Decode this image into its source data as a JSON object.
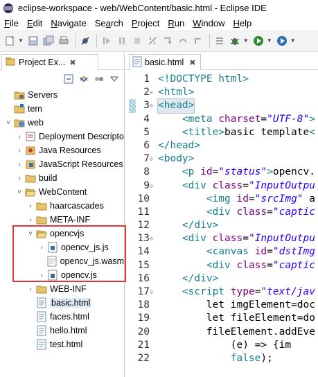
{
  "window": {
    "title": "eclipse-workspace - web/WebContent/basic.html - Eclipse IDE"
  },
  "menu": [
    {
      "label": "File",
      "mnemonic": "F"
    },
    {
      "label": "Edit",
      "mnemonic": "E"
    },
    {
      "label": "Navigate",
      "mnemonic": "N"
    },
    {
      "label": "Search",
      "mnemonic": "a"
    },
    {
      "label": "Project",
      "mnemonic": "P"
    },
    {
      "label": "Run",
      "mnemonic": "R"
    },
    {
      "label": "Window",
      "mnemonic": "W"
    },
    {
      "label": "Help",
      "mnemonic": "H"
    }
  ],
  "explorer": {
    "tab_label": "Project Ex...",
    "tab_close": "✖",
    "items": [
      {
        "label": "Servers",
        "indent": 0,
        "arrow": "",
        "icon": "servers-folder-icon",
        "selected": false
      },
      {
        "label": "tem",
        "indent": 0,
        "arrow": "",
        "icon": "project-icon",
        "selected": false
      },
      {
        "label": "web",
        "indent": 0,
        "arrow": "˅",
        "icon": "web-project-icon",
        "selected": false
      },
      {
        "label": "Deployment Descripto",
        "indent": 1,
        "arrow": "›",
        "icon": "deployment-icon",
        "selected": false
      },
      {
        "label": "Java Resources",
        "indent": 1,
        "arrow": "›",
        "icon": "java-resources-icon",
        "selected": false
      },
      {
        "label": "JavaScript Resources",
        "indent": 1,
        "arrow": "›",
        "icon": "js-resources-icon",
        "selected": false
      },
      {
        "label": "build",
        "indent": 1,
        "arrow": "›",
        "icon": "folder-icon",
        "selected": false
      },
      {
        "label": "WebContent",
        "indent": 1,
        "arrow": "˅",
        "icon": "open-folder-icon",
        "selected": false
      },
      {
        "label": "haarcascades",
        "indent": 2,
        "arrow": "›",
        "icon": "folder-icon",
        "selected": false
      },
      {
        "label": "META-INF",
        "indent": 2,
        "arrow": "›",
        "icon": "folder-icon",
        "selected": false
      },
      {
        "label": "opencvjs",
        "indent": 2,
        "arrow": "˅",
        "icon": "open-folder-icon",
        "selected": false
      },
      {
        "label": "opencv_js.js",
        "indent": 3,
        "arrow": "›",
        "icon": "js-file-icon",
        "selected": false
      },
      {
        "label": "opencv_js.wasm",
        "indent": 3,
        "arrow": "",
        "icon": "file-icon",
        "selected": false
      },
      {
        "label": "opencv.js",
        "indent": 3,
        "arrow": "›",
        "icon": "js-file-icon",
        "selected": false
      },
      {
        "label": "WEB-INF",
        "indent": 2,
        "arrow": "›",
        "icon": "folder-icon",
        "selected": false
      },
      {
        "label": "basic.html",
        "indent": 2,
        "arrow": "",
        "icon": "html-file-icon",
        "selected": true
      },
      {
        "label": "faces.html",
        "indent": 2,
        "arrow": "",
        "icon": "html-file-icon",
        "selected": false
      },
      {
        "label": "hello.html",
        "indent": 2,
        "arrow": "",
        "icon": "html-file-icon",
        "selected": false
      },
      {
        "label": "test.html",
        "indent": 2,
        "arrow": "",
        "icon": "html-file-icon",
        "selected": false
      }
    ]
  },
  "editor": {
    "tab_label": "basic.html",
    "tab_close": "✖",
    "lines": [
      {
        "n": "1",
        "fold": "",
        "parts": [
          [
            "doctype",
            "<!DOCTYPE html>"
          ]
        ]
      },
      {
        "n": "2",
        "fold": "⊖",
        "parts": [
          [
            "tag",
            "<html>"
          ]
        ]
      },
      {
        "n": "3",
        "fold": "⊖",
        "current": true,
        "parts": [
          [
            "tag",
            "<head>"
          ]
        ]
      },
      {
        "n": "4",
        "fold": "",
        "parts": [
          [
            "plain",
            "    "
          ],
          [
            "tag",
            "<meta "
          ],
          [
            "attr",
            "charset"
          ],
          [
            "plain",
            "="
          ],
          [
            "val",
            "\"UTF-8\""
          ],
          [
            "tag",
            ">"
          ]
        ]
      },
      {
        "n": "5",
        "fold": "",
        "parts": [
          [
            "plain",
            "    "
          ],
          [
            "tag",
            "<title>"
          ],
          [
            "plain",
            "basic template"
          ],
          [
            "tag",
            "<"
          ]
        ]
      },
      {
        "n": "6",
        "fold": "",
        "parts": [
          [
            "tag",
            "</head>"
          ]
        ]
      },
      {
        "n": "7",
        "fold": "⊖",
        "parts": [
          [
            "tag",
            "<body>"
          ]
        ]
      },
      {
        "n": "8",
        "fold": "",
        "parts": [
          [
            "plain",
            "    "
          ],
          [
            "tag",
            "<p "
          ],
          [
            "attr",
            "id"
          ],
          [
            "plain",
            "="
          ],
          [
            "val",
            "\"status\""
          ],
          [
            "tag",
            ">"
          ],
          [
            "plain",
            "opencv."
          ]
        ]
      },
      {
        "n": "9",
        "fold": "⊖",
        "parts": [
          [
            "plain",
            "    "
          ],
          [
            "tag",
            "<div "
          ],
          [
            "attr",
            "class"
          ],
          [
            "plain",
            "="
          ],
          [
            "val",
            "\"InputOutpu"
          ]
        ]
      },
      {
        "n": "10",
        "fold": "",
        "parts": [
          [
            "plain",
            "        "
          ],
          [
            "tag",
            "<img "
          ],
          [
            "attr",
            "id"
          ],
          [
            "plain",
            "="
          ],
          [
            "val",
            "\"srcImg\""
          ],
          [
            "plain",
            " a"
          ]
        ]
      },
      {
        "n": "11",
        "fold": "",
        "parts": [
          [
            "plain",
            "        "
          ],
          [
            "tag",
            "<div "
          ],
          [
            "attr",
            "class"
          ],
          [
            "plain",
            "="
          ],
          [
            "val",
            "\"captic"
          ]
        ]
      },
      {
        "n": "12",
        "fold": "",
        "parts": [
          [
            "plain",
            "    "
          ],
          [
            "tag",
            "</div>"
          ]
        ]
      },
      {
        "n": "13",
        "fold": "⊖",
        "parts": [
          [
            "plain",
            "    "
          ],
          [
            "tag",
            "<div "
          ],
          [
            "attr",
            "class"
          ],
          [
            "plain",
            "="
          ],
          [
            "val",
            "\"InputOutpu"
          ]
        ]
      },
      {
        "n": "14",
        "fold": "",
        "parts": [
          [
            "plain",
            "        "
          ],
          [
            "tag",
            "<canvas "
          ],
          [
            "attr",
            "id"
          ],
          [
            "plain",
            "="
          ],
          [
            "val",
            "\"dstImg"
          ]
        ]
      },
      {
        "n": "15",
        "fold": "",
        "parts": [
          [
            "plain",
            "        "
          ],
          [
            "tag",
            "<div "
          ],
          [
            "attr",
            "class"
          ],
          [
            "plain",
            "="
          ],
          [
            "val",
            "\"captic"
          ]
        ]
      },
      {
        "n": "16",
        "fold": "",
        "parts": [
          [
            "plain",
            "    "
          ],
          [
            "tag",
            "</div>"
          ]
        ]
      },
      {
        "n": "17",
        "fold": "⊖",
        "parts": [
          [
            "plain",
            "    "
          ],
          [
            "tag",
            "<script "
          ],
          [
            "attr",
            "type"
          ],
          [
            "plain",
            "="
          ],
          [
            "val",
            "\"text/jav"
          ]
        ]
      },
      {
        "n": "18",
        "fold": "",
        "parts": [
          [
            "plain",
            "        let imgElement=doc"
          ]
        ]
      },
      {
        "n": "19",
        "fold": "",
        "parts": [
          [
            "plain",
            "        let fileElement=do"
          ]
        ]
      },
      {
        "n": "20",
        "fold": "",
        "parts": [
          [
            "plain",
            "        fileElement.addEve"
          ]
        ]
      },
      {
        "n": "21",
        "fold": "",
        "parts": [
          [
            "plain",
            "            (e) => {im"
          ]
        ]
      },
      {
        "n": "22",
        "fold": "",
        "parts": [
          [
            "plain",
            "            "
          ],
          [
            "tag",
            "false"
          ],
          [
            "plain",
            ");"
          ]
        ]
      }
    ]
  },
  "colors": {
    "highlight_box": "#d93a3a",
    "selection": "#dbe8f7",
    "tag": "#17808c",
    "attribute": "#7f007f",
    "string": "#2a00ff"
  }
}
